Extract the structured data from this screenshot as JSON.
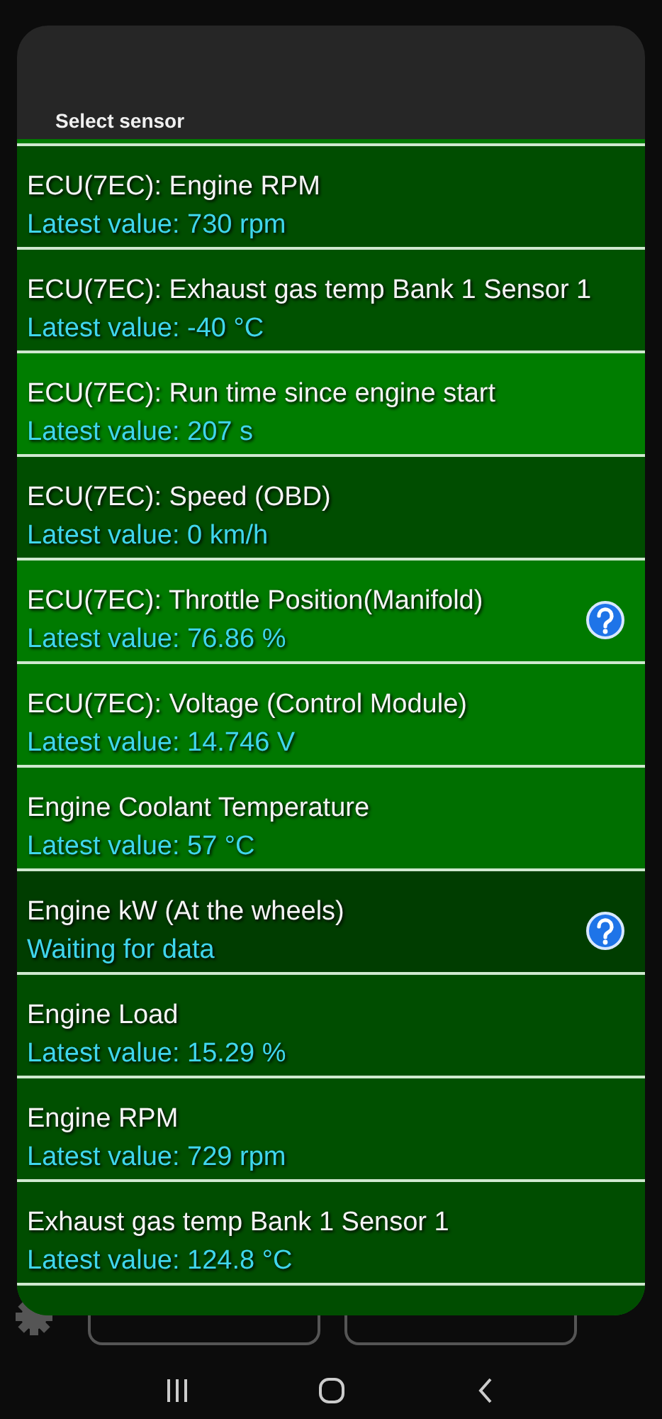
{
  "dialog": {
    "title": "Select sensor"
  },
  "sensors": [
    {
      "name": "ECU(7EC): Engine RPM",
      "value": "Latest value: 730 rpm",
      "color": "#004d00",
      "help": false
    },
    {
      "name": "ECU(7EC): Exhaust gas temp Bank 1 Sensor 1",
      "value": "Latest value: -40 °C",
      "color": "#005200",
      "help": false
    },
    {
      "name": "ECU(7EC): Run time since engine start",
      "value": "Latest value: 207 s",
      "color": "#007d00",
      "help": false
    },
    {
      "name": "ECU(7EC): Speed (OBD)",
      "value": "Latest value: 0 km/h",
      "color": "#004d00",
      "help": false
    },
    {
      "name": "ECU(7EC): Throttle Position(Manifold)",
      "value": "Latest value: 76.86 %",
      "color": "#007a00",
      "help": true
    },
    {
      "name": "ECU(7EC): Voltage (Control Module)",
      "value": "Latest value: 14.746 V",
      "color": "#007800",
      "help": false
    },
    {
      "name": "Engine Coolant Temperature",
      "value": "Latest value: 57 °C",
      "color": "#006f00",
      "help": false
    },
    {
      "name": "Engine kW (At the wheels)",
      "value": "Waiting for data",
      "color": "#003d00",
      "help": true
    },
    {
      "name": "Engine Load",
      "value": "Latest value: 15.29 %",
      "color": "#004d00",
      "help": false
    },
    {
      "name": "Engine RPM",
      "value": "Latest value: 729 rpm",
      "color": "#005000",
      "help": false
    },
    {
      "name": "Exhaust gas temp Bank 1 Sensor 1",
      "value": "Latest value: 124.8 °C",
      "color": "#004d00",
      "help": false
    }
  ]
}
